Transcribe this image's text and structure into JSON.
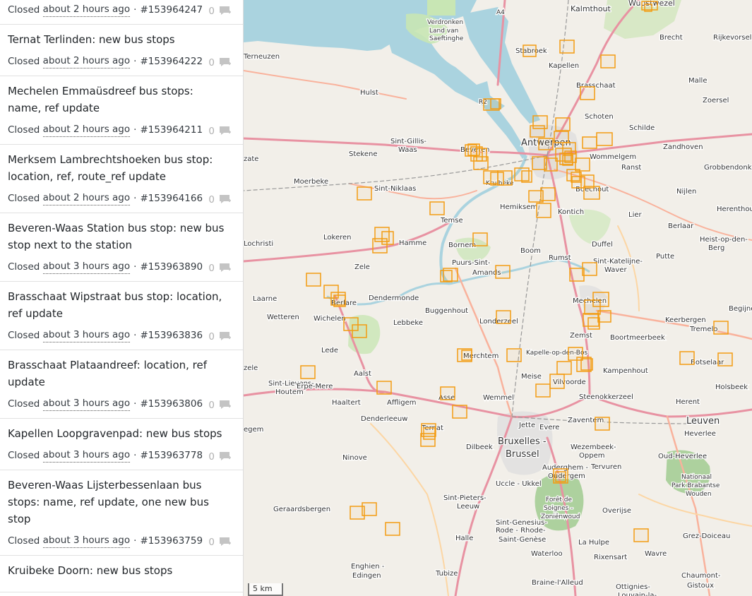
{
  "changesets": [
    {
      "title": "",
      "status": "Closed",
      "time": "about 2 hours ago",
      "id": "#153964247",
      "comments": "0"
    },
    {
      "title": "Ternat Terlinden: new bus stops",
      "status": "Closed",
      "time": "about 2 hours ago",
      "id": "#153964222",
      "comments": "0"
    },
    {
      "title": "Mechelen Emmaüsdreef bus stops: name, ref update",
      "status": "Closed",
      "time": "about 2 hours ago",
      "id": "#153964211",
      "comments": "0"
    },
    {
      "title": "Merksem Lambrechtshoeken bus stop: location, ref, route_ref update",
      "status": "Closed",
      "time": "about 2 hours ago",
      "id": "#153964166",
      "comments": "0"
    },
    {
      "title": "Beveren-Waas Station bus stop: new bus stop next to the station",
      "status": "Closed",
      "time": "about 3 hours ago",
      "id": "#153963890",
      "comments": "0"
    },
    {
      "title": "Brasschaat Wipstraat bus stop: location, ref update",
      "status": "Closed",
      "time": "about 3 hours ago",
      "id": "#153963836",
      "comments": "0"
    },
    {
      "title": "Brasschaat Plataandreef: location, ref update",
      "status": "Closed",
      "time": "about 3 hours ago",
      "id": "#153963806",
      "comments": "0"
    },
    {
      "title": "Kapellen Loopgravenpad: new bus stops",
      "status": "Closed",
      "time": "about 3 hours ago",
      "id": "#153963778",
      "comments": "0"
    },
    {
      "title": "Beveren-Waas Lijsterbessenlaan bus stops: name, ref update, one new bus stop",
      "status": "Closed",
      "time": "about 3 hours ago",
      "id": "#153963759",
      "comments": "0"
    },
    {
      "title": "Kruibeke Doorn: new bus stops",
      "status": "",
      "time": "",
      "id": "",
      "comments": ""
    }
  ],
  "map": {
    "scale_label": "5 km",
    "labels": {
      "kalmthout": "Kalmthout",
      "wuustwezel": "Wuustwezel",
      "brecht": "Brecht",
      "rijkevorsel": "Rijkevorsel",
      "verdronken": "Verdronken",
      "landvan": "Land van",
      "saeftinghe": "Saeftinghe",
      "a4": "A4",
      "terneuzen": "Terneuzen",
      "stabroek": "Stabroek",
      "kapellen": "Kapellen",
      "malle": "Malle",
      "hulst": "Hulst",
      "brasschaat": "Brasschaat",
      "zoersel": "Zoersel",
      "schoten": "Schoten",
      "schilde": "Schilde",
      "sintgillis": "Sint-Gillis-",
      "waas": "Waas",
      "antwerpen": "Antwerpen",
      "wommelgem": "Wommelgem",
      "zandhoven": "Zandhoven",
      "stekene": "Stekene",
      "beveren": "Beveren",
      "ranst": "Ranst",
      "grobbendonk": "Grobbendonk",
      "moerbeke": "Moerbeke",
      "kruibeke": "Kruibeke",
      "boechout": "Boechout",
      "sintniklaas": "Sint-Niklaas",
      "hemiksem": "Hemiksem",
      "kontich": "Kontich",
      "nijlen": "Nijlen",
      "herenthout": "Herenthout",
      "lier": "Lier",
      "temse": "Temse",
      "berlaar": "Berlaar",
      "lokeren": "Lokeren",
      "hamme": "Hamme",
      "bornem": "Bornem",
      "duffel": "Duffel",
      "lochristi": "Lochristi",
      "heistopden": "Heist-op-den-",
      "berg": "Berg",
      "boom": "Boom",
      "rumst": "Rumst",
      "putte": "Putte",
      "zele": "Zele",
      "puurssint": "Puurs-Sint-",
      "amands": "Amands",
      "sintkatelijne": "Sint-Katelijne-",
      "waver": "Waver",
      "laarne": "Laarne",
      "berlare": "Berlare",
      "dendermonde": "Dendermonde",
      "mechelen": "Mechelen",
      "begijnendijk": "Begijnendijk",
      "wetteren": "Wetteren",
      "wichelen": "Wichelen",
      "buggenhout": "Buggenhout",
      "keerbergen": "Keerbergen",
      "lebbeke": "Lebbeke",
      "londerzeel": "Londerzeel",
      "zemst": "Zemst",
      "boortmeerbeek": "Boortmeerbeek",
      "tremelo": "Tremelo",
      "lede": "Lede",
      "merchtem": "Merchtem",
      "kapelleopdenbos": "Kapelle-op-den-Bos",
      "zele2": "zele",
      "meise": "Meise",
      "kampenhout": "Kampenhout",
      "aalst": "Aalst",
      "vilvoorde": "Vilvoorde",
      "botselaar": "Botselaar",
      "sintlievens": "Sint-Lievens-",
      "houtem": "Houtem",
      "erpemere": "Erpe-Mere",
      "affligem": "Affligem",
      "asse": "Asse",
      "wemmel": "Wemmel",
      "steenokkerzeel": "Steenokkerzeel",
      "herent": "Herent",
      "holsbeek": "Holsbeek",
      "haaltert": "Haaltert",
      "denderleeuw": "Denderleeuw",
      "zaventem": "Zaventem",
      "ternat": "Ternat",
      "jette": "Jette",
      "evere": "Evere",
      "leuven": "Leuven",
      "heverlee": "Heverlee",
      "egem": "egem",
      "bruxelles": "Bruxelles -",
      "brussel": "Brussel",
      "wezembeek": "Wezembeek-",
      "oppem": "Oppem",
      "oudheverlee": "Oud-Heverlee",
      "ninove": "Ninove",
      "dilbeek": "Dilbeek",
      "tervuren": "Tervuren",
      "auderghem": "Auderghem -",
      "oudergem": "Oudergem",
      "nationaal": "Nationaal",
      "parkbrabantse": "Park Brabantse",
      "wouden": "Wouden",
      "ucclekkel": "Uccle - Ukkel",
      "geraardsbergen": "Geraardsbergen",
      "sintpieters": "Sint-Pieters-",
      "leeuw": "Leeuw",
      "foret": "Forêt de",
      "soignes": "Soignes -",
      "zonienwoud": "Zoniënwoud",
      "overijse": "Overijse",
      "sintgenesius": "Sint-Genesius-",
      "rodee": "Rode - Rhode-",
      "saintgenese": "Saint-Genèse",
      "halle": "Halle",
      "lahulpe": "La Hulpe",
      "grezdoiceau": "Grez-Doiceau",
      "waterloo": "Waterloo",
      "rixensart": "Rixensart",
      "wavre": "Wavre",
      "enghien": "Enghien -",
      "edingen": "Edingen",
      "tubize": "Tubize",
      "braine": "Braine-l'Alleud",
      "ottignies": "Ottignies-",
      "louvainla": "Louvain-la-",
      "chaumont": "Chaumont-",
      "gistoux": "Gistoux",
      "zate": "zate",
      "r2": "R2"
    },
    "accent_color": "#f39c12"
  }
}
